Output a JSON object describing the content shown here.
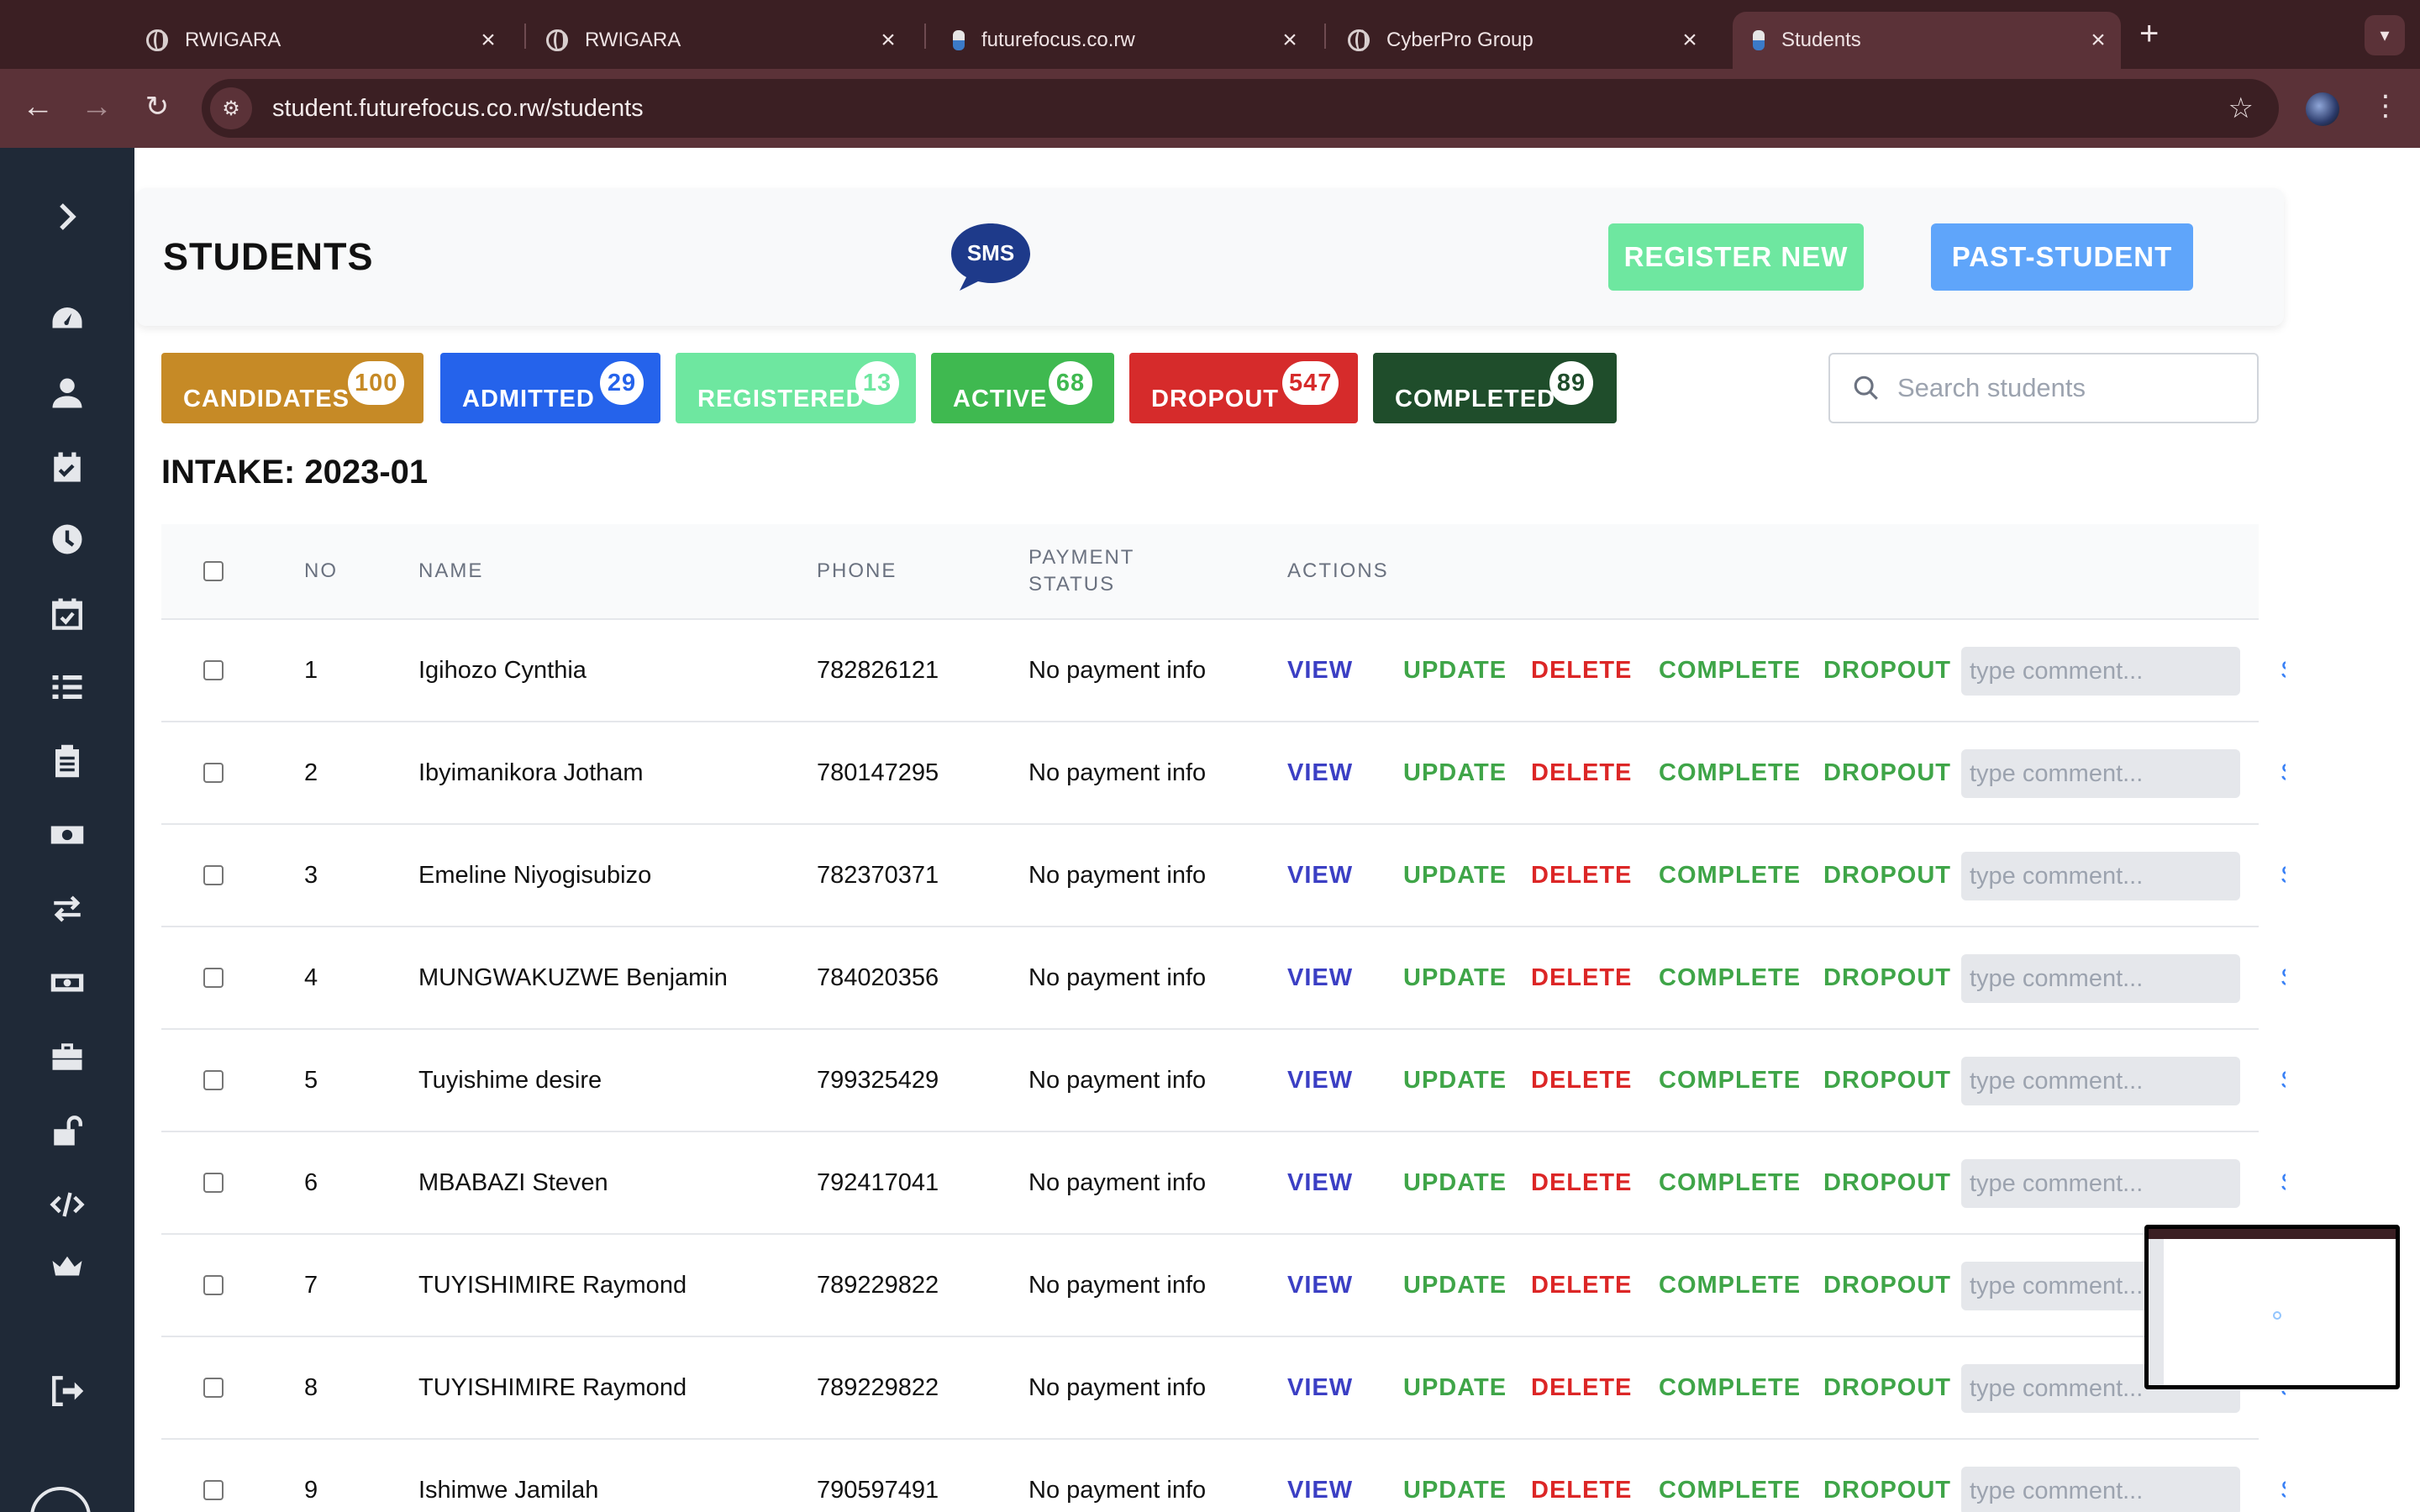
{
  "browser": {
    "tabs": [
      {
        "title": "RWIGARA",
        "icon": "globe-icon",
        "active": false
      },
      {
        "title": "RWIGARA",
        "icon": "globe-icon",
        "active": false
      },
      {
        "title": "futurefocus.co.rw",
        "icon": "site-favicon",
        "active": false
      },
      {
        "title": "CyberPro Group",
        "icon": "globe-icon",
        "active": false
      },
      {
        "title": "Students",
        "icon": "site-favicon",
        "active": true
      }
    ],
    "new_tab": "+",
    "url": "student.futurefocus.co.rw/students"
  },
  "sidebar": {
    "toggle_icon": "chevron-right-icon",
    "items": [
      "dashboard-icon",
      "user-icon",
      "calendar-check-icon",
      "clock-icon",
      "calendar-icon",
      "list-icon",
      "clipboard-icon",
      "money-icon",
      "transfer-icon",
      "cash-icon",
      "toolbox-icon",
      "unlock-icon",
      "code-icon",
      "crown-icon",
      "logout-icon"
    ]
  },
  "header": {
    "title": "STUDENTS",
    "logo_text": "SMS",
    "register_label": "REGISTER NEW",
    "past_label": "PAST-STUDENT"
  },
  "filters": [
    {
      "label": "CANDIDATES",
      "count": "100",
      "color": "#c68a26"
    },
    {
      "label": "ADMITTED",
      "count": "29",
      "color": "#2563eb"
    },
    {
      "label": "REGISTERED",
      "count": "13",
      "color": "#6ee7a0"
    },
    {
      "label": "ACTIVE",
      "count": "68",
      "color": "#3fb950"
    },
    {
      "label": "DROPOUT",
      "count": "547",
      "color": "#d62b2b"
    },
    {
      "label": "COMPLETED",
      "count": "89",
      "color": "#1f4d2b"
    }
  ],
  "search": {
    "placeholder": "Search students"
  },
  "intake": "INTAKE: 2023-01",
  "table": {
    "headers": {
      "no": "NO",
      "name": "NAME",
      "phone": "PHONE",
      "payment_1": "PAYMENT",
      "payment_2": "STATUS",
      "actions": "ACTIONS"
    },
    "actions": {
      "view": "VIEW",
      "update": "UPDATE",
      "delete": "DELETE",
      "complete": "COMPLETE",
      "dropout": "DROPOUT",
      "comment_placeholder": "type comment..."
    },
    "rows": [
      {
        "no": "1",
        "name": "Igihozo Cynthia",
        "phone": "782826121",
        "payment": "No payment info"
      },
      {
        "no": "2",
        "name": "Ibyimanikora Jotham",
        "phone": "780147295",
        "payment": "No payment info"
      },
      {
        "no": "3",
        "name": "Emeline Niyogisubizo",
        "phone": "782370371",
        "payment": "No payment info"
      },
      {
        "no": "4",
        "name": "MUNGWAKUZWE Benjamin",
        "phone": "784020356",
        "payment": "No payment info"
      },
      {
        "no": "5",
        "name": "Tuyishime desire",
        "phone": "799325429",
        "payment": "No payment info"
      },
      {
        "no": "6",
        "name": "MBABAZI Steven",
        "phone": "792417041",
        "payment": "No payment info"
      },
      {
        "no": "7",
        "name": "TUYISHIMIRE Raymond",
        "phone": "789229822",
        "payment": "No payment info"
      },
      {
        "no": "8",
        "name": "TUYISHIMIRE Raymond",
        "phone": "789229822",
        "payment": "No payment info"
      },
      {
        "no": "9",
        "name": "Ishimwe Jamilah",
        "phone": "790597491",
        "payment": "No payment info"
      }
    ]
  }
}
